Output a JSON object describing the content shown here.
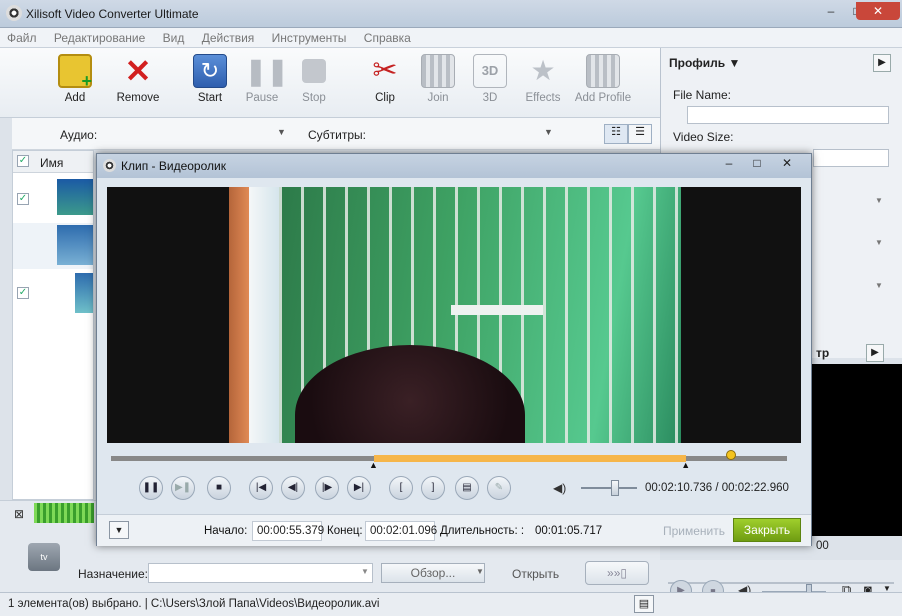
{
  "window": {
    "title": "Xilisoft Video Converter Ultimate",
    "min": "–",
    "max": "□",
    "close": "✕"
  },
  "menu": [
    "Файл",
    "Редактирование",
    "Вид",
    "Действия",
    "Инструменты",
    "Справка"
  ],
  "toolbar": {
    "add": "Add",
    "remove": "Remove",
    "start": "Start",
    "pause": "Pause",
    "stop": "Stop",
    "clip": "Clip",
    "join": "Join",
    "threed": "3D",
    "effects": "Effects",
    "add_profile": "Add Profile"
  },
  "options": {
    "audio_label": "Аудио:",
    "subtitles_label": "Субтитры:"
  },
  "list": {
    "name_header": "Имя"
  },
  "profile": {
    "title": "Профиль ▼",
    "file_name_label": "File Name:",
    "video_size_label": "Video Size:"
  },
  "preview_partial": {
    "label": "тр",
    "time": "00"
  },
  "bottom": {
    "destination_label": "Назначение:",
    "browse_button": "Обзор...",
    "open_button": "Открыть"
  },
  "status": {
    "text": "1 элемента(ов) выбрано. | C:\\Users\\Злой Папа\\Videos\\Видеоролик.avi"
  },
  "dialog": {
    "title": "Клип - Видеоролик",
    "time_display": "00:02:10.736 / 00:02:22.960",
    "start_label": "Начало:",
    "start_value": "00:00:55.379",
    "end_label": "Конец:",
    "end_value": "00:02:01.096",
    "duration_label": "Длительность: :",
    "duration_value": "00:01:05.717",
    "apply_button": "Применить",
    "close_button": "Закрыть"
  },
  "colors": {
    "accent": "#8ab61f",
    "selection": "#f6b64a"
  },
  "playback": {
    "selection_start": 0.389,
    "selection_end": 0.851,
    "playhead": 0.917,
    "volume": 0.6
  }
}
